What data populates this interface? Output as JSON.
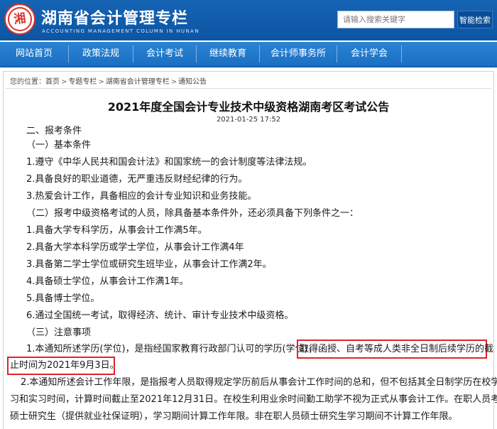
{
  "header": {
    "logo_icon": "hunan-accounting-seal-icon",
    "logo_text": "湘",
    "title": "湖南省会计管理专栏",
    "subtitle": "ACCOUNTING MANAGEMENT COLUMN IN HUNAN",
    "search_placeholder": "请输入搜索关键字",
    "search_button": "智能检索"
  },
  "nav": [
    "网站首页",
    "政策法规",
    "会计考试",
    "继续教育",
    "会计师事务所",
    "会计学会"
  ],
  "breadcrumb": {
    "prefix": "您的位置：",
    "items": [
      "首页",
      "专题专栏",
      "湖南省会计管理专栏",
      "通知公告"
    ],
    "separator": ">"
  },
  "article": {
    "title": "2021年度全国会计专业技术中级资格湖南考区考试公告",
    "date": "2021-01-25 17:52",
    "lines": [
      "二、报考条件",
      "（一）基本条件",
      "1.遵守《中华人民共和国会计法》和国家统一的会计制度等法律法规。",
      "2.具备良好的职业道德，无严重违反财经纪律的行为。",
      "3.热爱会计工作，具备相应的会计专业知识和业务技能。",
      "（二）报考中级资格考试的人员，除具备基本条件外，还必须具备下列条件之一：",
      "1.具备大学专科学历，从事会计工作满5年。",
      "2.具备大学本科学历或学士学位，从事会计工作满4年",
      "3.具备第二学士学位或研究生班毕业，从事会计工作满2年。",
      "4.具备硕士学位，从事会计工作满1年。",
      "5.具备博士学位。",
      "6.通过全国统一考试，取得经济、统计、审计专业技术中级资格。",
      "（三）注意事项"
    ],
    "note1_prefix": "1.本通知所述学历(学位)，是指经国家教育行政部门认可的学历(学位)，",
    "note1_highlight_a": "取得函授、自考等成人类非全日制后续学历的截",
    "note1_highlight_b": "止时间为2021年9月3日。",
    "note2_lines": [
      "2.本通知所述会计工作年限，是指报考人员取得规定学历前后从事会计工作时间的总和，但不包括其全日制学历在校学",
      "习和实习时间，计算时间截止至2021年12月31日。在校生利用业余时间勤工助学不视为正式从事会计工作。在职人员考取",
      "硕士研究生（提供就业社保证明），学习期间计算工作年限。非在职人员硕士研究生学习期间不计算工作年限。"
    ]
  }
}
